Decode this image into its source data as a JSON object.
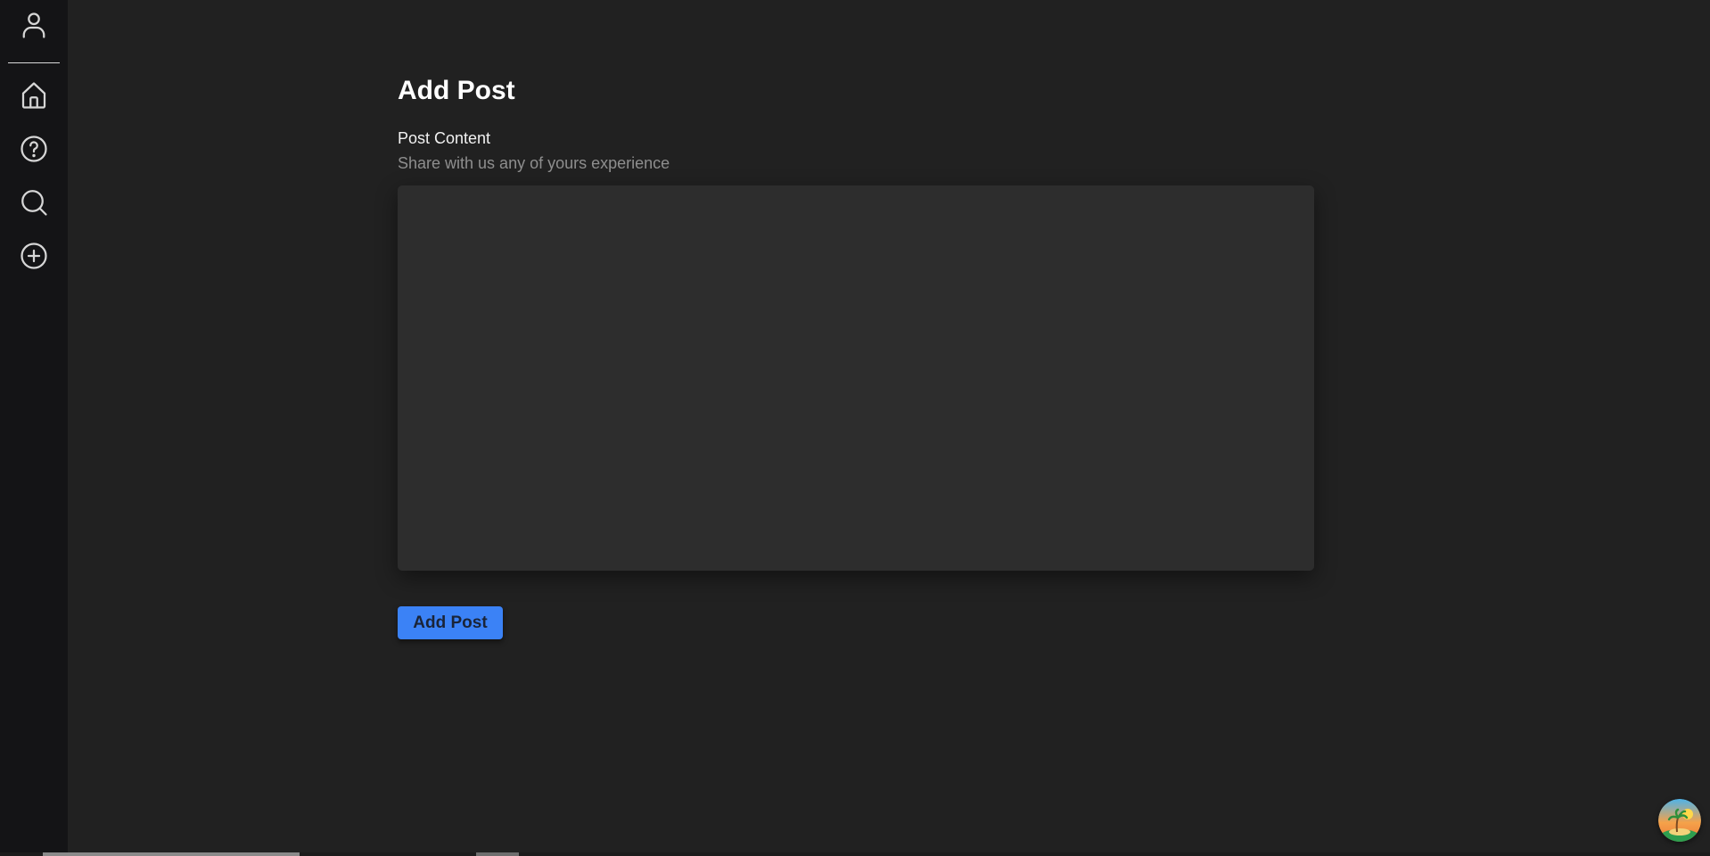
{
  "sidebar": {
    "profile_icon": "user-icon",
    "items": [
      {
        "key": "home",
        "icon": "home-icon"
      },
      {
        "key": "help",
        "icon": "question-circle-icon"
      },
      {
        "key": "search",
        "icon": "search-icon"
      },
      {
        "key": "add",
        "icon": "plus-circle-icon"
      }
    ]
  },
  "main": {
    "title": "Add Post",
    "content_label": "Post Content",
    "content_hint": "Share with us any of yours experience",
    "content_value": "",
    "submit_label": "Add Post"
  },
  "corner_widget": {
    "icon": "palm-island-avatar-icon"
  },
  "colors": {
    "background": "#212121",
    "sidebar": "#141416",
    "textarea": "#2d2d2d",
    "accent": "#3b82f6",
    "hint_text": "#8e8e8e"
  }
}
